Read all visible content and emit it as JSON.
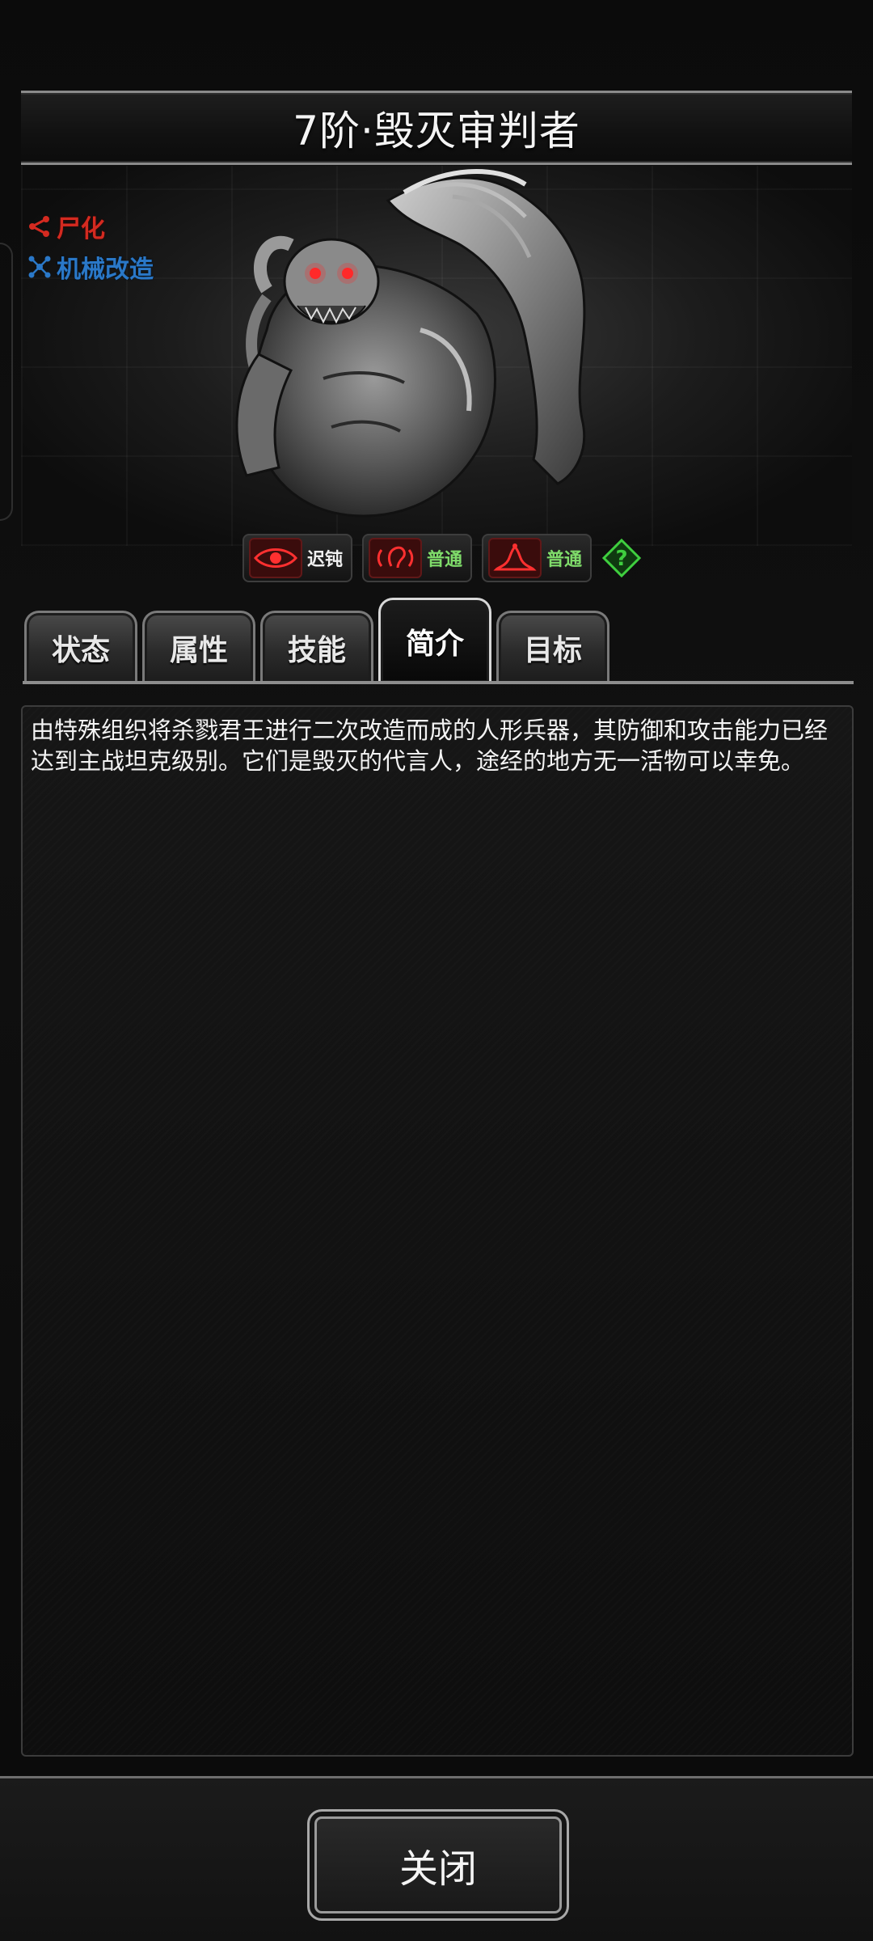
{
  "header": {
    "title": "7阶·毁灭审判者"
  },
  "traits": [
    {
      "label": "尸化",
      "color": "#d42a20",
      "icon": "share-nodes-icon"
    },
    {
      "label": "机械改造",
      "color": "#2a78c8",
      "icon": "network-nodes-icon"
    }
  ],
  "status_icons": [
    {
      "icon": "eye-icon",
      "label": "迟钝",
      "label_color": "#f0f0f0"
    },
    {
      "icon": "ear-icon",
      "label": "普通",
      "label_color": "#7fdc6a"
    },
    {
      "icon": "smell-icon",
      "label": "普通",
      "label_color": "#7fdc6a"
    },
    {
      "icon": "question-icon",
      "label": ""
    }
  ],
  "tabs": [
    {
      "label": "状态",
      "active": false
    },
    {
      "label": "属性",
      "active": false
    },
    {
      "label": "技能",
      "active": false
    },
    {
      "label": "简介",
      "active": true
    },
    {
      "label": "目标",
      "active": false
    }
  ],
  "description": "由特殊组织将杀戮君王进行二次改造而成的人形兵器，其防御和攻击能力已经达到主战坦克级别。它们是毁灭的代言人，途经的地方无一活物可以幸免。",
  "footer": {
    "close_label": "关闭"
  },
  "colors": {
    "accent_red": "#e02828",
    "accent_blue": "#2a78c8",
    "accent_green": "#3fcf3f"
  }
}
